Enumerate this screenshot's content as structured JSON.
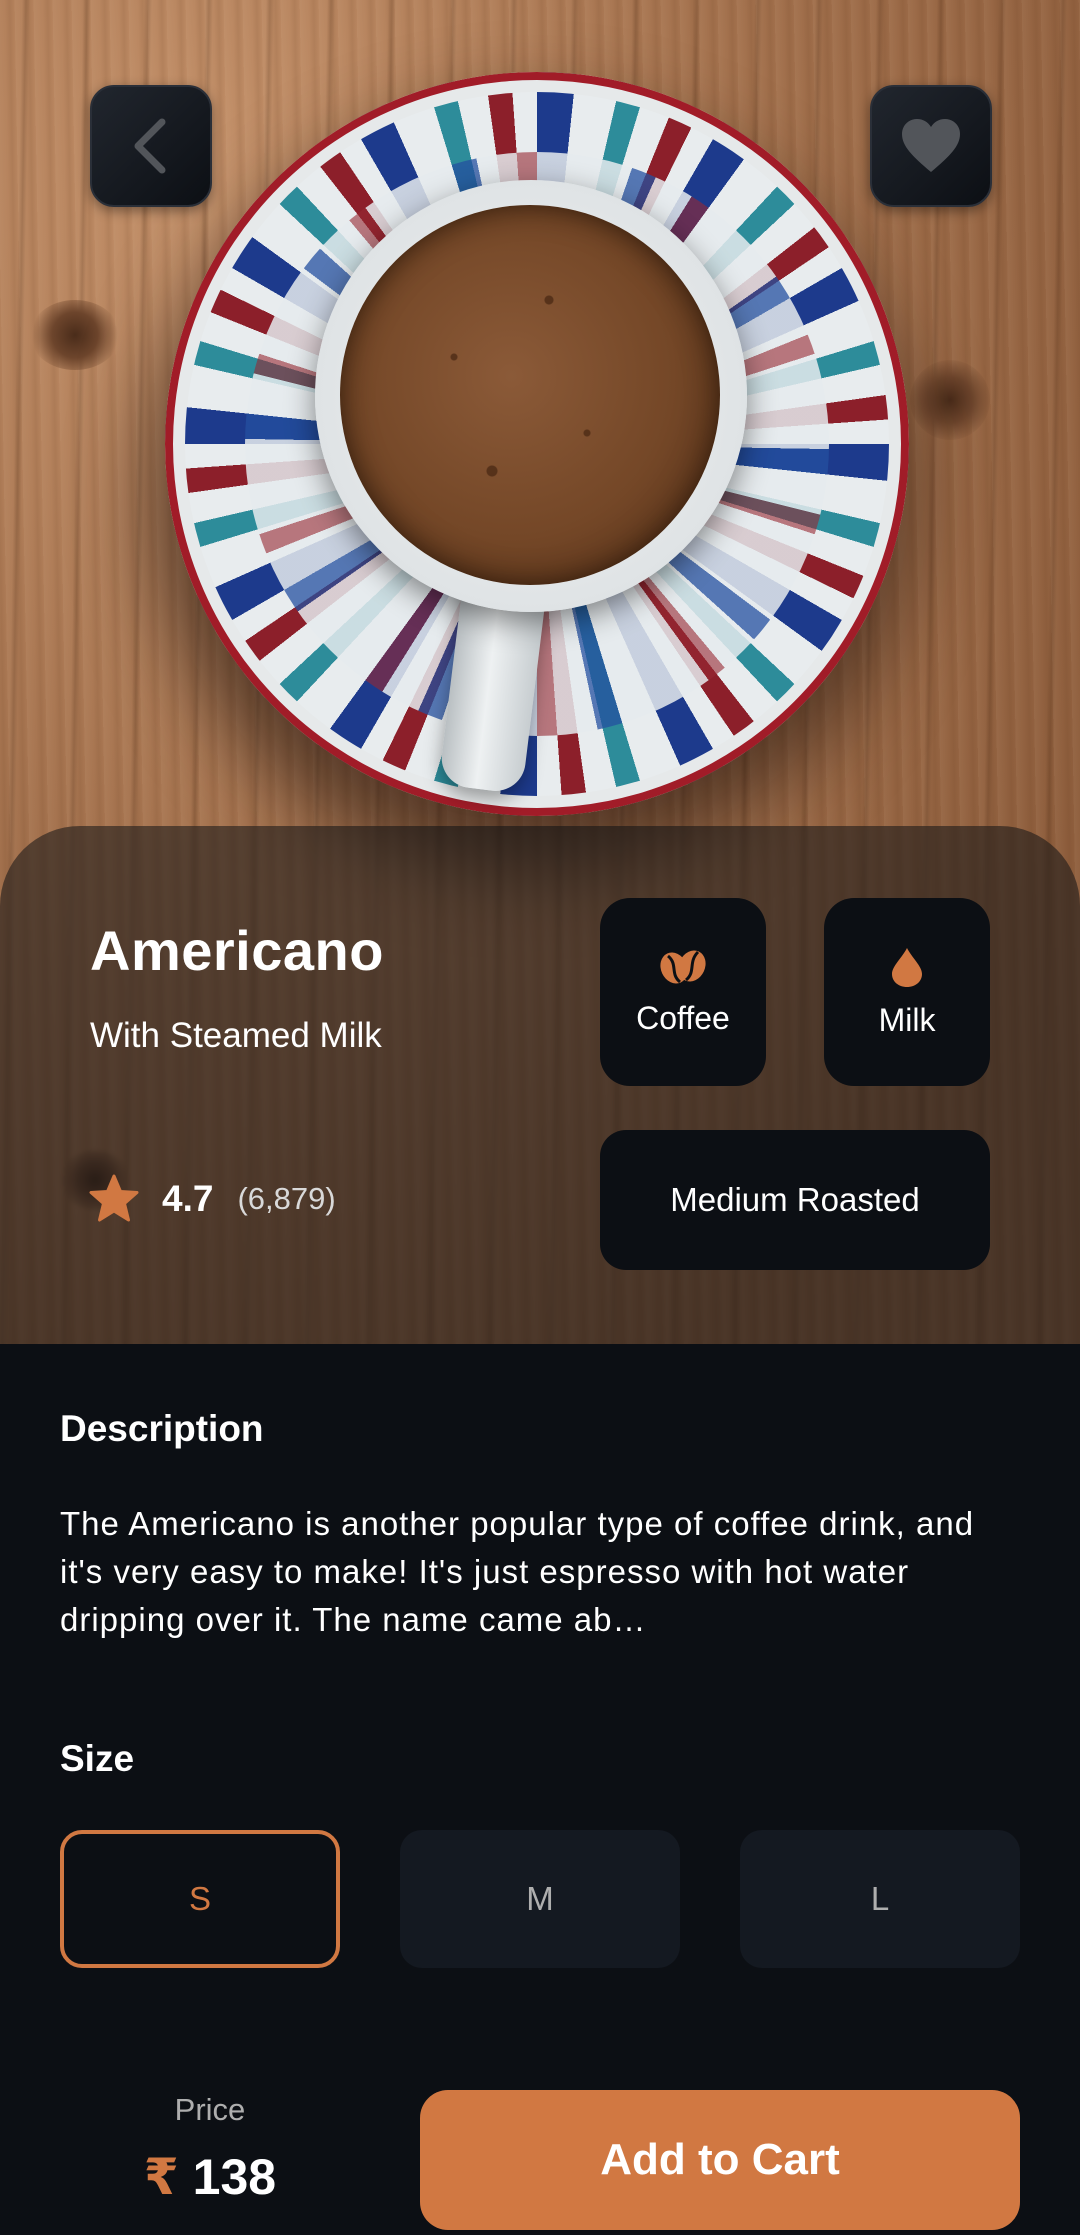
{
  "product": {
    "name": "Americano",
    "subtitle": "With Steamed Milk",
    "rating": "4.7",
    "rating_count": "(6,879)",
    "ingredients": [
      {
        "label": "Coffee",
        "icon": "coffee-beans-icon"
      },
      {
        "label": "Milk",
        "icon": "milk-drop-icon"
      }
    ],
    "roast": "Medium Roasted"
  },
  "description": {
    "title": "Description",
    "text": "The Americano is another popular type of coffee drink, and it's very easy to make! It's just espresso with hot water dripping over it. The name came ab…"
  },
  "size": {
    "title": "Size",
    "options": [
      "S",
      "M",
      "L"
    ],
    "selected": "S"
  },
  "price": {
    "label": "Price",
    "currency": "₹",
    "value": "138"
  },
  "actions": {
    "add_to_cart": "Add to Cart"
  },
  "colors": {
    "accent": "#D17842",
    "background": "#0C0F14",
    "surface": "#141921"
  },
  "icons": {
    "back": "chevron-left-icon",
    "favorite": "heart-icon",
    "rating": "star-icon"
  }
}
